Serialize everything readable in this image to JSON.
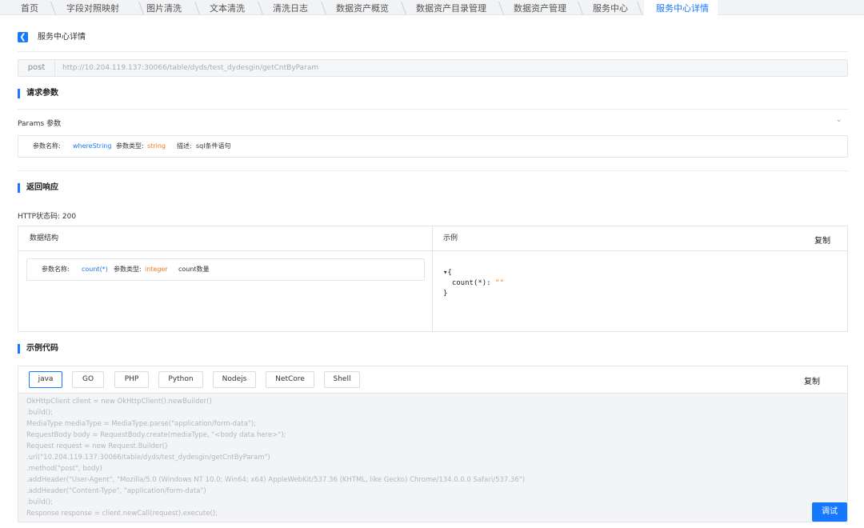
{
  "tabs": [
    {
      "label": "首页",
      "active": false
    },
    {
      "label": "字段对照映射",
      "active": false
    },
    {
      "label": "图片清洗",
      "active": false
    },
    {
      "label": "文本清洗",
      "active": false
    },
    {
      "label": "清洗日志",
      "active": false
    },
    {
      "label": "数据资产概览",
      "active": false
    },
    {
      "label": "数据资产目录管理",
      "active": false
    },
    {
      "label": "数据资产管理",
      "active": false
    },
    {
      "label": "服务中心",
      "active": false
    },
    {
      "label": "服务中心详情",
      "active": true
    }
  ],
  "header": {
    "title": "服务中心详情",
    "back_icon": "chevron-left-icon"
  },
  "request": {
    "method": "post",
    "url": "http://10.204.119.137:30066/table/dyds/test_dydesgin/getCntByParam"
  },
  "request_params": {
    "section_title": "请求参数",
    "params_label": "Params 参数",
    "param": {
      "name_label": "参数名称:",
      "name": "whereString",
      "type_label": "参数类型:",
      "type": "string",
      "desc_label": "描述:",
      "desc": "sql条件语句"
    }
  },
  "response": {
    "section_title": "返回响应",
    "http_status": "HTTP状态码: 200",
    "structure_header": "数据结构",
    "example_header": "示例",
    "copy_label": "复制",
    "field": {
      "name_label": "参数名称:",
      "name": "count(*)",
      "type_label": "参数类型:",
      "type": "integer",
      "desc": "count数量"
    },
    "json_open": "▾{",
    "json_key": "  count(*): ",
    "json_value": "\"\"",
    "json_close": "}"
  },
  "sample_code": {
    "section_title": "示例代码",
    "copy_label": "复制",
    "languages": [
      "java",
      "GO",
      "PHP",
      "Python",
      "Nodejs",
      "NetCore",
      "Shell"
    ],
    "active_language": "java",
    "lines": [
      "OkHttpClient client = new OkHttpClient().newBuilder()",
      "      .build();",
      "MediaType mediaType = MediaType.parse(\"application/form-data\");",
      "RequestBody body = RequestBody.create(mediaType, \"<body data here>\");",
      "Request request = new Request.Builder()",
      "      .url(\"10.204.119.137:30066/table/dyds/test_dydesgin/getCntByParam\")",
      "      .method(\"post\", body)",
      "      .addHeader(\"User-Agent\", \"Mozilla/5.0 (Windows NT 10.0; Win64; x64) AppleWebKit/537.36 (KHTML, like Gecko) Chrome/134.0.0.0 Safari/537.36\")",
      "      .addHeader(\"Content-Type\", \"application/form-data\")",
      "      .build();",
      "Response response = client.newCall(request).execute();"
    ],
    "debug_label": "调试"
  }
}
